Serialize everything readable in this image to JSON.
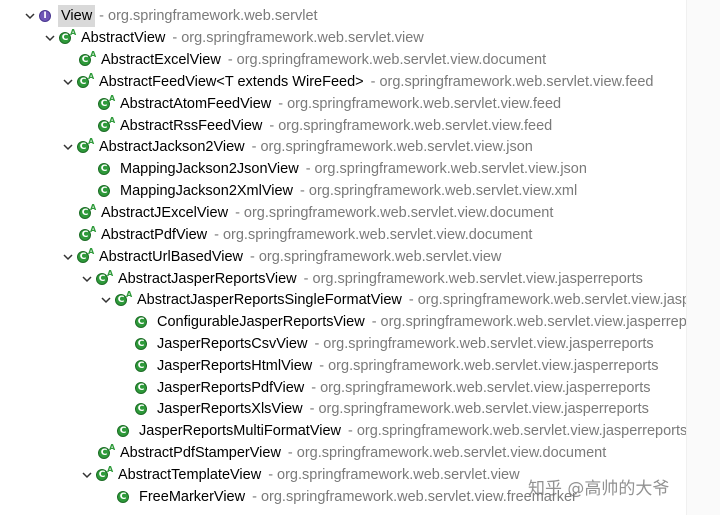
{
  "separator": "-",
  "watermark": "知乎 @高帅的大爷",
  "tree": [
    {
      "name": "View",
      "pkg": "org.springframework.web.servlet",
      "icon": "interface-icon",
      "abstract": false,
      "expanded": true,
      "selected": true
    },
    {
      "name": "AbstractView",
      "pkg": "org.springframework.web.servlet.view",
      "icon": "class-icon",
      "abstract": true,
      "expanded": true
    },
    {
      "name": "AbstractExcelView",
      "pkg": "org.springframework.web.servlet.view.document",
      "icon": "class-icon",
      "abstract": true,
      "expanded": null
    },
    {
      "name": "AbstractFeedView<T extends WireFeed>",
      "pkg": "org.springframework.web.servlet.view.feed",
      "icon": "class-icon",
      "abstract": true,
      "expanded": true
    },
    {
      "name": "AbstractAtomFeedView",
      "pkg": "org.springframework.web.servlet.view.feed",
      "icon": "class-icon",
      "abstract": true,
      "expanded": null
    },
    {
      "name": "AbstractRssFeedView",
      "pkg": "org.springframework.web.servlet.view.feed",
      "icon": "class-icon",
      "abstract": true,
      "expanded": null
    },
    {
      "name": "AbstractJackson2View",
      "pkg": "org.springframework.web.servlet.view.json",
      "icon": "class-icon",
      "abstract": true,
      "expanded": true
    },
    {
      "name": "MappingJackson2JsonView",
      "pkg": "org.springframework.web.servlet.view.json",
      "icon": "class-icon",
      "abstract": false,
      "expanded": null
    },
    {
      "name": "MappingJackson2XmlView",
      "pkg": "org.springframework.web.servlet.view.xml",
      "icon": "class-icon",
      "abstract": false,
      "expanded": null
    },
    {
      "name": "AbstractJExcelView",
      "pkg": "org.springframework.web.servlet.view.document",
      "icon": "class-icon",
      "abstract": true,
      "expanded": null
    },
    {
      "name": "AbstractPdfView",
      "pkg": "org.springframework.web.servlet.view.document",
      "icon": "class-icon",
      "abstract": true,
      "expanded": null
    },
    {
      "name": "AbstractUrlBasedView",
      "pkg": "org.springframework.web.servlet.view",
      "icon": "class-icon",
      "abstract": true,
      "expanded": true
    },
    {
      "name": "AbstractJasperReportsView",
      "pkg": "org.springframework.web.servlet.view.jasperreports",
      "icon": "class-icon",
      "abstract": true,
      "expanded": true
    },
    {
      "name": "AbstractJasperReportsSingleFormatView",
      "pkg": "org.springframework.web.servlet.view.jasperreports",
      "icon": "class-icon",
      "abstract": true,
      "expanded": true
    },
    {
      "name": "ConfigurableJasperReportsView",
      "pkg": "org.springframework.web.servlet.view.jasperreports",
      "icon": "class-icon",
      "abstract": false,
      "expanded": null
    },
    {
      "name": "JasperReportsCsvView",
      "pkg": "org.springframework.web.servlet.view.jasperreports",
      "icon": "class-icon",
      "abstract": false,
      "expanded": null
    },
    {
      "name": "JasperReportsHtmlView",
      "pkg": "org.springframework.web.servlet.view.jasperreports",
      "icon": "class-icon",
      "abstract": false,
      "expanded": null
    },
    {
      "name": "JasperReportsPdfView",
      "pkg": "org.springframework.web.servlet.view.jasperreports",
      "icon": "class-icon",
      "abstract": false,
      "expanded": null
    },
    {
      "name": "JasperReportsXlsView",
      "pkg": "org.springframework.web.servlet.view.jasperreports",
      "icon": "class-icon",
      "abstract": false,
      "expanded": null
    },
    {
      "name": "JasperReportsMultiFormatView",
      "pkg": "org.springframework.web.servlet.view.jasperreports",
      "icon": "class-icon",
      "abstract": false,
      "expanded": null
    },
    {
      "name": "AbstractPdfStamperView",
      "pkg": "org.springframework.web.servlet.view.document",
      "icon": "class-icon",
      "abstract": true,
      "expanded": null
    },
    {
      "name": "AbstractTemplateView",
      "pkg": "org.springframework.web.servlet.view",
      "icon": "class-icon",
      "abstract": true,
      "expanded": true
    },
    {
      "name": "FreeMarkerView",
      "pkg": "org.springframework.web.servlet.view.freemarker",
      "icon": "class-icon",
      "abstract": false,
      "expanded": null
    }
  ],
  "colors": {
    "class": "#2e9a3a",
    "interface": "#6f56b6",
    "package": "#7a7a7a",
    "selection": "#d9d9d9"
  }
}
